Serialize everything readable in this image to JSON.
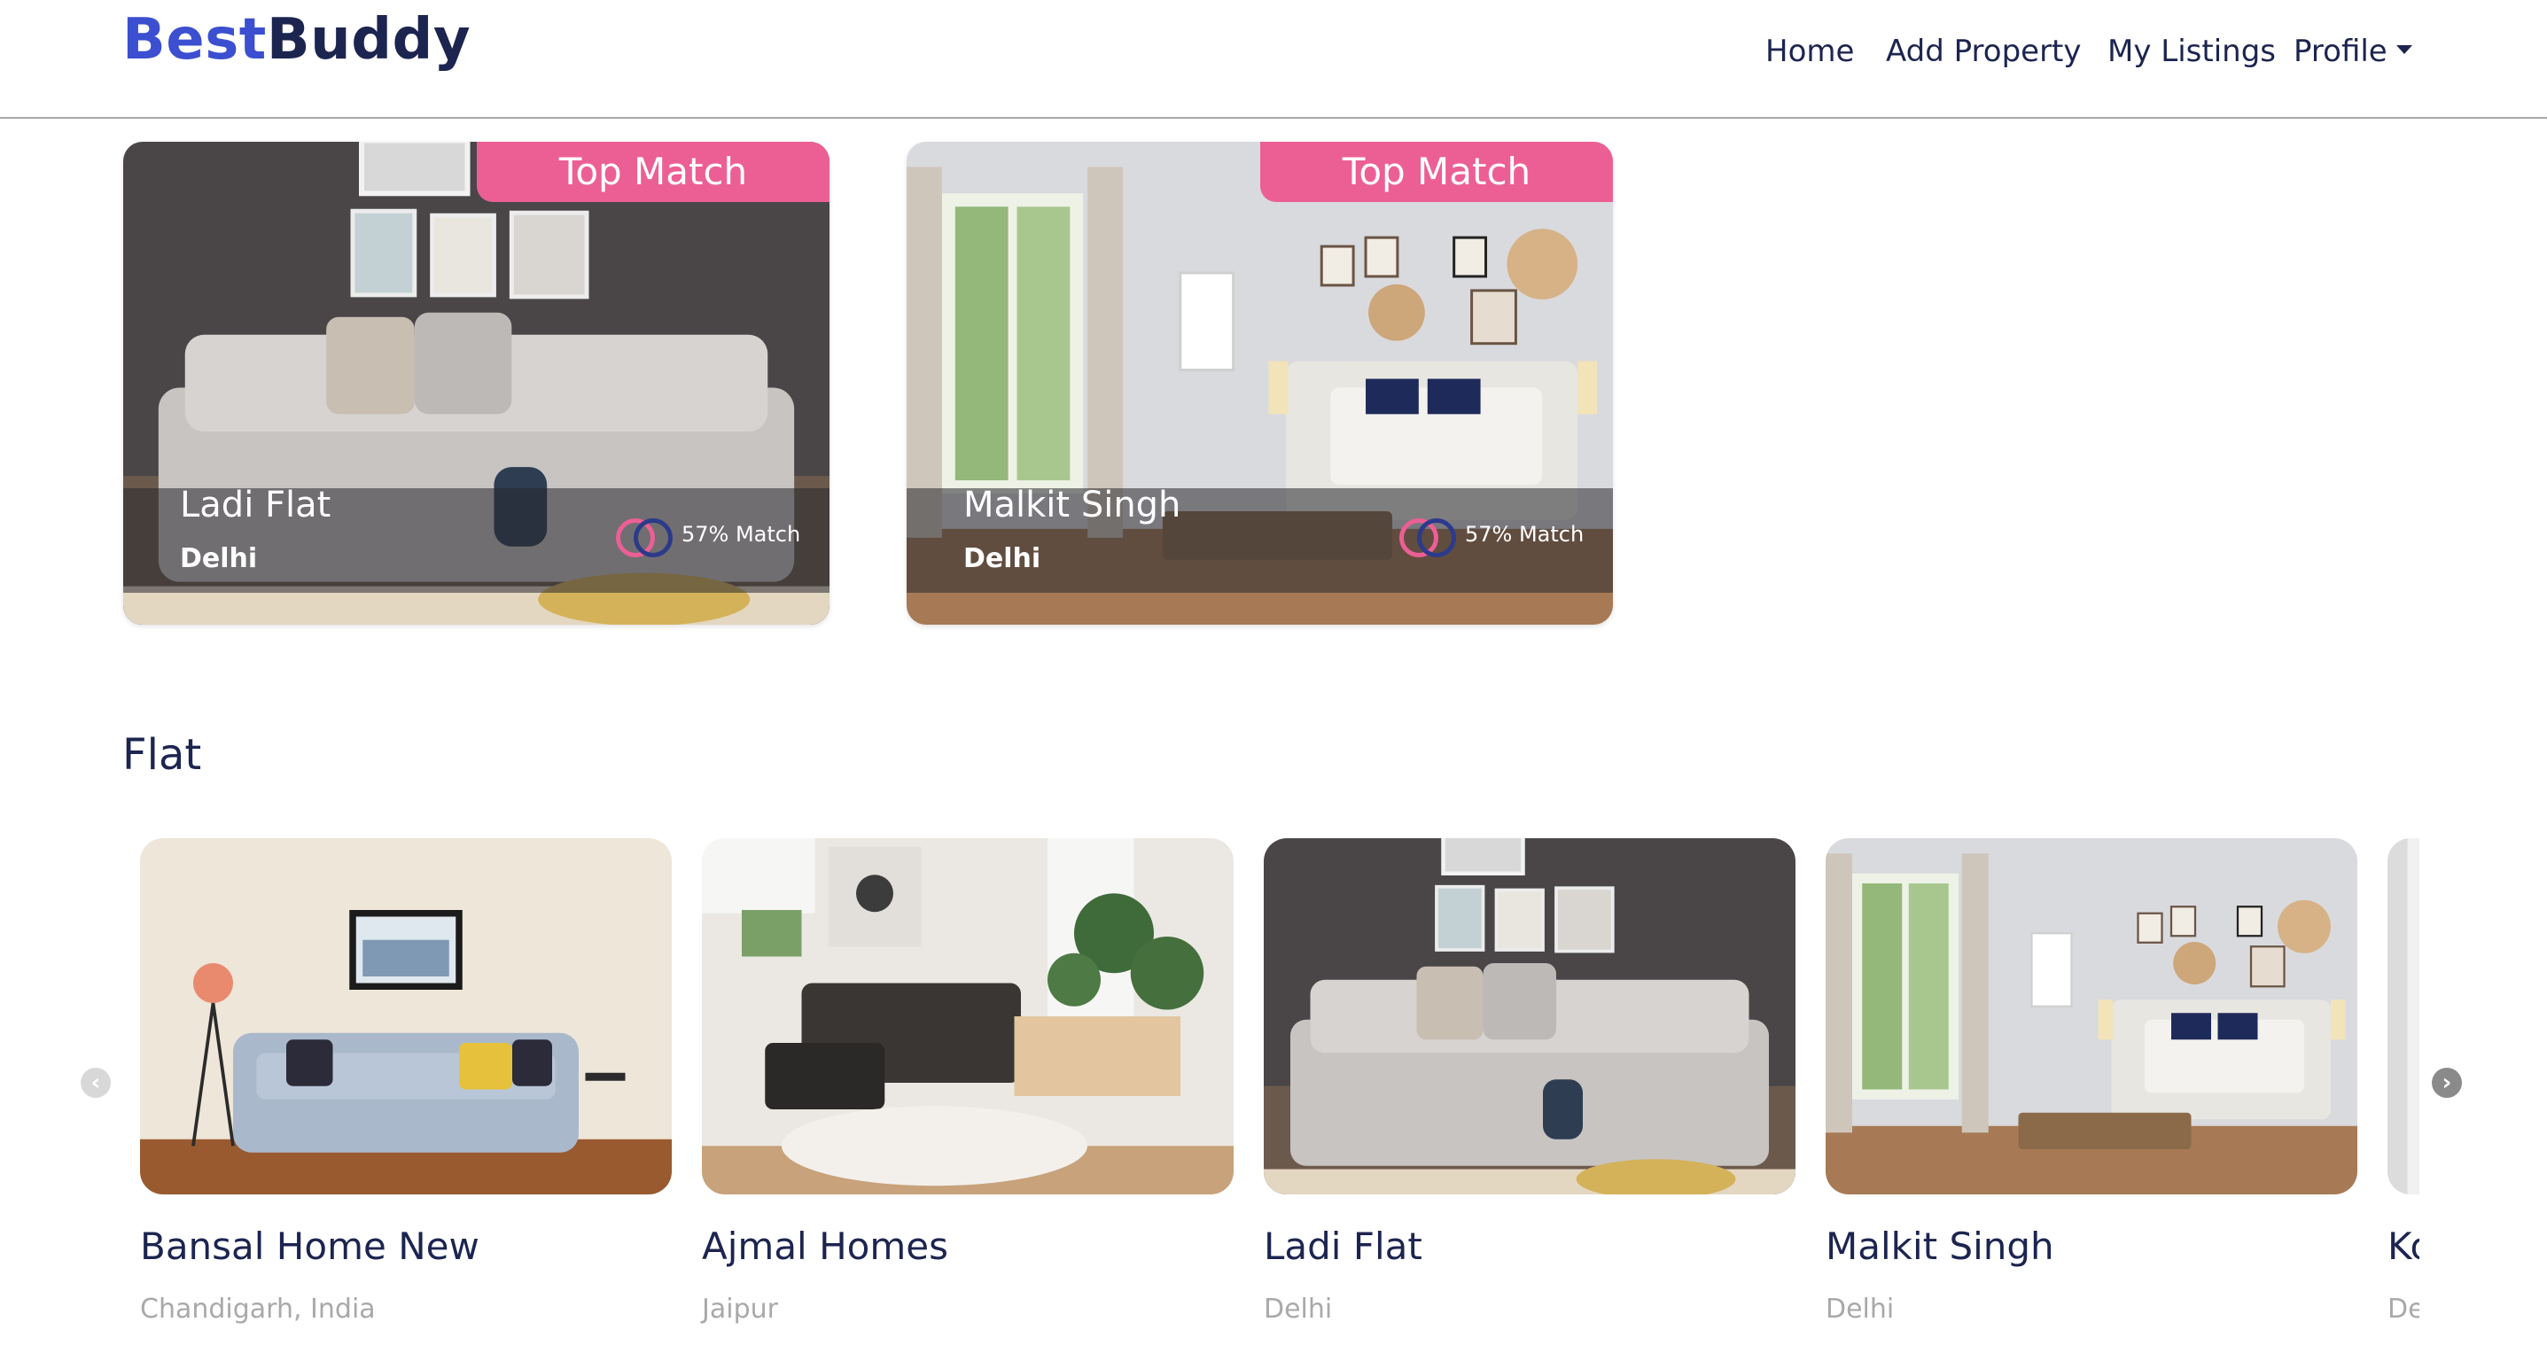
{
  "navbar": {
    "brand_part1": "Best",
    "brand_part2": "Buddy",
    "links": [
      "Home",
      "Add Property",
      "My Listings"
    ],
    "profile": "Profile"
  },
  "top_matches": [
    {
      "badge": "Top Match",
      "title": "Ladi Flat",
      "city": "Delhi",
      "match": "57% Match"
    },
    {
      "badge": "Top Match",
      "title": "Malkit Singh",
      "city": "Delhi",
      "match": "57% Match"
    }
  ],
  "section": {
    "title": "Flat"
  },
  "listings": [
    {
      "name": "Bansal Home New",
      "location": "Chandigarh, India"
    },
    {
      "name": "Ajmal Homes",
      "location": "Jaipur"
    },
    {
      "name": "Ladi Flat",
      "location": "Delhi"
    },
    {
      "name": "Malkit Singh",
      "location": "Delhi"
    },
    {
      "name": "Ko",
      "location": "De"
    }
  ],
  "colors": {
    "accent": "#ec5f95",
    "brand": "#3b4fd0",
    "navy": "#1c2550"
  }
}
